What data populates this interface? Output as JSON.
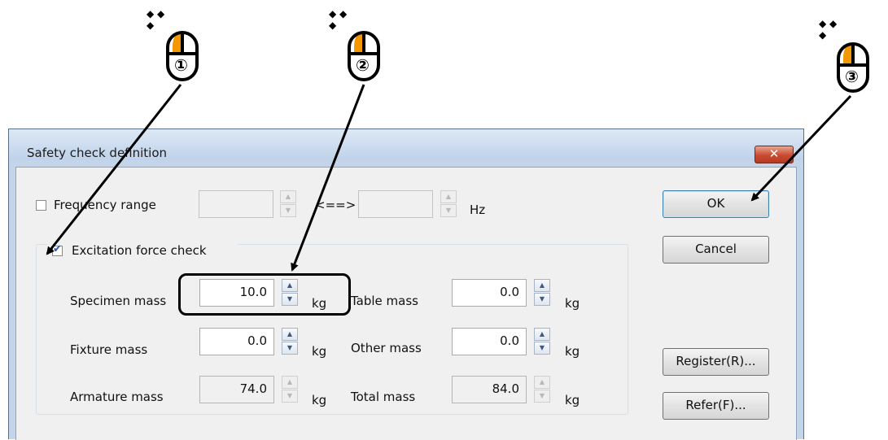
{
  "dialog": {
    "title": "Safety check definition",
    "close_glyph": "✕"
  },
  "frequency": {
    "label": "Frequency range",
    "checked": false,
    "from_value": "",
    "separator": "<==>",
    "to_value": "",
    "unit": "Hz"
  },
  "excitation": {
    "label": "Excitation force check",
    "checked": true
  },
  "masses": {
    "specimen": {
      "label": "Specimen mass",
      "value": "10.0",
      "unit": "kg"
    },
    "table": {
      "label": "Table mass",
      "value": "0.0",
      "unit": "kg"
    },
    "fixture": {
      "label": "Fixture  mass",
      "value": "0.0",
      "unit": "kg"
    },
    "other": {
      "label": "Other mass",
      "value": "0.0",
      "unit": "kg"
    },
    "armature": {
      "label": "Armature mass",
      "value": "74.0",
      "unit": "kg"
    },
    "total": {
      "label": "Total mass",
      "value": "84.0",
      "unit": "kg"
    }
  },
  "buttons": {
    "ok": "OK",
    "cancel": "Cancel",
    "register": "Register(R)...",
    "refer": "Refer(F)..."
  },
  "callouts": [
    "①",
    "②",
    "③"
  ],
  "colors": {
    "accent_orange": "#f39800",
    "dialog_frame": "#c4d5ea",
    "close_red": "#c94a2f"
  },
  "icons": {
    "mouse": "mouse-left-click-icon",
    "spin_up": "▲",
    "spin_down": "▼",
    "checkmark": "✔"
  }
}
